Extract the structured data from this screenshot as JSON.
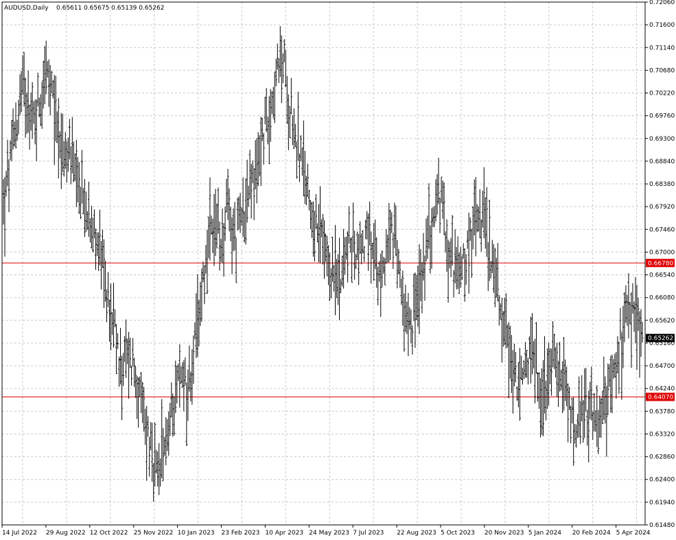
{
  "header": {
    "symbol_label": "AUDUSD,Daily",
    "ohlc_values": "0.65611 0.65675 0.65139 0.65262"
  },
  "chart_data": {
    "type": "bar",
    "style": "ohlc",
    "symbol": "AUDUSD",
    "timeframe": "Daily",
    "last_close": 0.65262,
    "ylim": [
      0.6148,
      0.7206
    ],
    "grid": true,
    "y_ticks": [
      "0.72060",
      "0.71600",
      "0.71140",
      "0.70680",
      "0.70220",
      "0.69760",
      "0.69300",
      "0.68840",
      "0.68380",
      "0.67920",
      "0.67460",
      "0.67000",
      "0.66540",
      "0.66080",
      "0.65620",
      "0.65160",
      "0.64700",
      "0.64240",
      "0.63780",
      "0.63320",
      "0.62860",
      "0.62400",
      "0.61940",
      "0.61480"
    ],
    "x_ticks": [
      "14 Jul 2022",
      "29 Aug 2022",
      "12 Oct 2022",
      "25 Nov 2022",
      "10 Jan 2023",
      "23 Feb 2023",
      "10 Apr 2023",
      "24 May 2023",
      "7 Jul 2023",
      "22 Aug 2023",
      "5 Oct 2023",
      "20 Nov 2023",
      "5 Jan 2024",
      "20 Feb 2024",
      "5 Apr 2024"
    ],
    "levels": [
      {
        "price": 0.6678,
        "label": "0.66780",
        "color": "#e00000"
      },
      {
        "price": 0.6407,
        "label": "0.64070",
        "color": "#e00000"
      }
    ],
    "current_price_label": "0.65262",
    "bar_count": 465,
    "anchors": [
      [
        0,
        0.67,
        0.686
      ],
      [
        3,
        0.676,
        0.691
      ],
      [
        7,
        0.684,
        0.699
      ],
      [
        10,
        0.691,
        0.704
      ],
      [
        14,
        0.696,
        0.707
      ],
      [
        17,
        0.694,
        0.708
      ],
      [
        22,
        0.689,
        0.705
      ],
      [
        26,
        0.693,
        0.709
      ],
      [
        30,
        0.699,
        0.714
      ],
      [
        34,
        0.695,
        0.709
      ],
      [
        38,
        0.689,
        0.703
      ],
      [
        42,
        0.686,
        0.698
      ],
      [
        46,
        0.683,
        0.696
      ],
      [
        50,
        0.684,
        0.693
      ],
      [
        54,
        0.679,
        0.688
      ],
      [
        58,
        0.678,
        0.686
      ],
      [
        62,
        0.673,
        0.68
      ],
      [
        66,
        0.67,
        0.677
      ],
      [
        70,
        0.666,
        0.676
      ],
      [
        74,
        0.658,
        0.67
      ],
      [
        78,
        0.651,
        0.663
      ],
      [
        82,
        0.644,
        0.658
      ],
      [
        86,
        0.639,
        0.653
      ],
      [
        90,
        0.64,
        0.655
      ],
      [
        94,
        0.641,
        0.654
      ],
      [
        97,
        0.637,
        0.65
      ],
      [
        100,
        0.633,
        0.645
      ],
      [
        103,
        0.629,
        0.641
      ],
      [
        106,
        0.626,
        0.637
      ],
      [
        109,
        0.62,
        0.632
      ],
      [
        112,
        0.618,
        0.631
      ],
      [
        115,
        0.623,
        0.636
      ],
      [
        118,
        0.626,
        0.638
      ],
      [
        121,
        0.629,
        0.642
      ],
      [
        124,
        0.633,
        0.645
      ],
      [
        127,
        0.637,
        0.65
      ],
      [
        130,
        0.641,
        0.652
      ],
      [
        133,
        0.636,
        0.648
      ],
      [
        136,
        0.64,
        0.653
      ],
      [
        139,
        0.645,
        0.658
      ],
      [
        142,
        0.652,
        0.664
      ],
      [
        145,
        0.659,
        0.671
      ],
      [
        148,
        0.663,
        0.675
      ],
      [
        151,
        0.667,
        0.68
      ],
      [
        154,
        0.669,
        0.682
      ],
      [
        157,
        0.665,
        0.678
      ],
      [
        160,
        0.668,
        0.681
      ],
      [
        163,
        0.672,
        0.686
      ],
      [
        166,
        0.669,
        0.68
      ],
      [
        169,
        0.666,
        0.678
      ],
      [
        172,
        0.669,
        0.681
      ],
      [
        175,
        0.672,
        0.684
      ],
      [
        178,
        0.675,
        0.688
      ],
      [
        181,
        0.679,
        0.69
      ],
      [
        184,
        0.681,
        0.695
      ],
      [
        187,
        0.685,
        0.699
      ],
      [
        190,
        0.688,
        0.702
      ],
      [
        193,
        0.692,
        0.706
      ],
      [
        196,
        0.696,
        0.71
      ],
      [
        199,
        0.699,
        0.713
      ],
      [
        202,
        0.702,
        0.714
      ],
      [
        204,
        0.699,
        0.715
      ],
      [
        207,
        0.695,
        0.709
      ],
      [
        210,
        0.691,
        0.703
      ],
      [
        213,
        0.686,
        0.698
      ],
      [
        216,
        0.682,
        0.695
      ],
      [
        219,
        0.679,
        0.691
      ],
      [
        222,
        0.675,
        0.688
      ],
      [
        225,
        0.672,
        0.683
      ],
      [
        228,
        0.67,
        0.679
      ],
      [
        231,
        0.668,
        0.678
      ],
      [
        234,
        0.664,
        0.674
      ],
      [
        237,
        0.662,
        0.671
      ],
      [
        240,
        0.66,
        0.67
      ],
      [
        243,
        0.658,
        0.671
      ],
      [
        246,
        0.662,
        0.673
      ],
      [
        249,
        0.664,
        0.676
      ],
      [
        252,
        0.665,
        0.679
      ],
      [
        255,
        0.666,
        0.678
      ],
      [
        258,
        0.663,
        0.675
      ],
      [
        261,
        0.665,
        0.677
      ],
      [
        264,
        0.668,
        0.679
      ],
      [
        267,
        0.665,
        0.676
      ],
      [
        270,
        0.662,
        0.672
      ],
      [
        273,
        0.66,
        0.67
      ],
      [
        276,
        0.662,
        0.674
      ],
      [
        279,
        0.665,
        0.677
      ],
      [
        282,
        0.664,
        0.679
      ],
      [
        285,
        0.662,
        0.676
      ],
      [
        288,
        0.659,
        0.67
      ],
      [
        291,
        0.656,
        0.666
      ],
      [
        294,
        0.652,
        0.664
      ],
      [
        297,
        0.65,
        0.662
      ],
      [
        300,
        0.654,
        0.666
      ],
      [
        303,
        0.657,
        0.67
      ],
      [
        306,
        0.661,
        0.675
      ],
      [
        309,
        0.665,
        0.679
      ],
      [
        312,
        0.669,
        0.683
      ],
      [
        315,
        0.671,
        0.688
      ],
      [
        318,
        0.673,
        0.686
      ],
      [
        321,
        0.669,
        0.68
      ],
      [
        324,
        0.665,
        0.676
      ],
      [
        327,
        0.661,
        0.672
      ],
      [
        330,
        0.659,
        0.67
      ],
      [
        333,
        0.662,
        0.672
      ],
      [
        336,
        0.664,
        0.675
      ],
      [
        339,
        0.666,
        0.678
      ],
      [
        342,
        0.668,
        0.682
      ],
      [
        345,
        0.671,
        0.688
      ],
      [
        348,
        0.67,
        0.687
      ],
      [
        351,
        0.667,
        0.681
      ],
      [
        354,
        0.663,
        0.676
      ],
      [
        357,
        0.66,
        0.671
      ],
      [
        360,
        0.655,
        0.666
      ],
      [
        363,
        0.651,
        0.662
      ],
      [
        366,
        0.647,
        0.658
      ],
      [
        369,
        0.642,
        0.653
      ],
      [
        372,
        0.638,
        0.649
      ],
      [
        375,
        0.636,
        0.647
      ],
      [
        378,
        0.64,
        0.65
      ],
      [
        381,
        0.643,
        0.654
      ],
      [
        384,
        0.644,
        0.656
      ],
      [
        387,
        0.641,
        0.652
      ],
      [
        390,
        0.638,
        0.648
      ],
      [
        393,
        0.637,
        0.647
      ],
      [
        396,
        0.64,
        0.651
      ],
      [
        399,
        0.642,
        0.655
      ],
      [
        402,
        0.641,
        0.653
      ],
      [
        405,
        0.638,
        0.65
      ],
      [
        408,
        0.636,
        0.647
      ],
      [
        411,
        0.632,
        0.643
      ],
      [
        414,
        0.63,
        0.64
      ],
      [
        417,
        0.628,
        0.638
      ],
      [
        420,
        0.63,
        0.641
      ],
      [
        423,
        0.633,
        0.644
      ],
      [
        426,
        0.631,
        0.642
      ],
      [
        429,
        0.629,
        0.639
      ],
      [
        432,
        0.63,
        0.64
      ],
      [
        435,
        0.632,
        0.643
      ],
      [
        438,
        0.634,
        0.646
      ],
      [
        441,
        0.637,
        0.649
      ],
      [
        444,
        0.64,
        0.653
      ],
      [
        447,
        0.643,
        0.656
      ],
      [
        450,
        0.646,
        0.66
      ],
      [
        453,
        0.649,
        0.663
      ],
      [
        456,
        0.65,
        0.664
      ],
      [
        459,
        0.648,
        0.662
      ],
      [
        462,
        0.651,
        0.66
      ],
      [
        464,
        0.6514,
        0.6568
      ]
    ]
  }
}
